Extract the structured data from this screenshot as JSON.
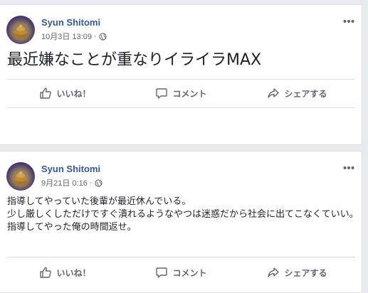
{
  "posts": [
    {
      "author": "Syun Shitomi",
      "timestamp": "10月3日 13:09",
      "privacy_icon": "globe-icon",
      "text": "最近嫌なことが重なりイライラMAX",
      "actions": {
        "like": "いいね！",
        "comment": "コメント",
        "share": "シェアする"
      }
    },
    {
      "author": "Syun Shitomi",
      "timestamp": "9月21日 0:16",
      "privacy_icon": "globe-icon",
      "text": "指導してやっていた後輩が最近休んでいる。\n少し厳しくしただけですぐ潰れるようなやつは迷惑だから社会に出てこなくていい。\n指導してやった俺の時間返せ。",
      "actions": {
        "like": "いいね！",
        "comment": "コメント",
        "share": "シェアする"
      }
    }
  ],
  "colors": {
    "name_link": "#365899",
    "meta": "#616770",
    "action": "#606770",
    "background": "#e9ebee"
  }
}
